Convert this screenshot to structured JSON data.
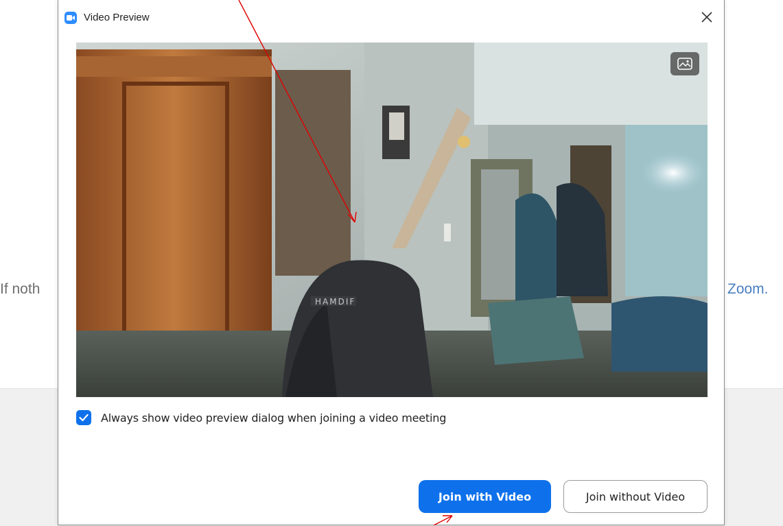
{
  "background": {
    "text_left": "If noth",
    "text_right": "Zoom."
  },
  "dialog": {
    "app_icon": "zoom-camera-icon",
    "title": "Video Preview",
    "close_icon": "close-icon",
    "background_icon": "image-icon",
    "option": {
      "checked": true,
      "label": "Always show video preview dialog when joining a video meeting"
    },
    "buttons": {
      "join_video": "Join with Video",
      "join_without": "Join without Video"
    }
  },
  "colors": {
    "accent": "#0e71eb",
    "annotation": "#e00000"
  }
}
